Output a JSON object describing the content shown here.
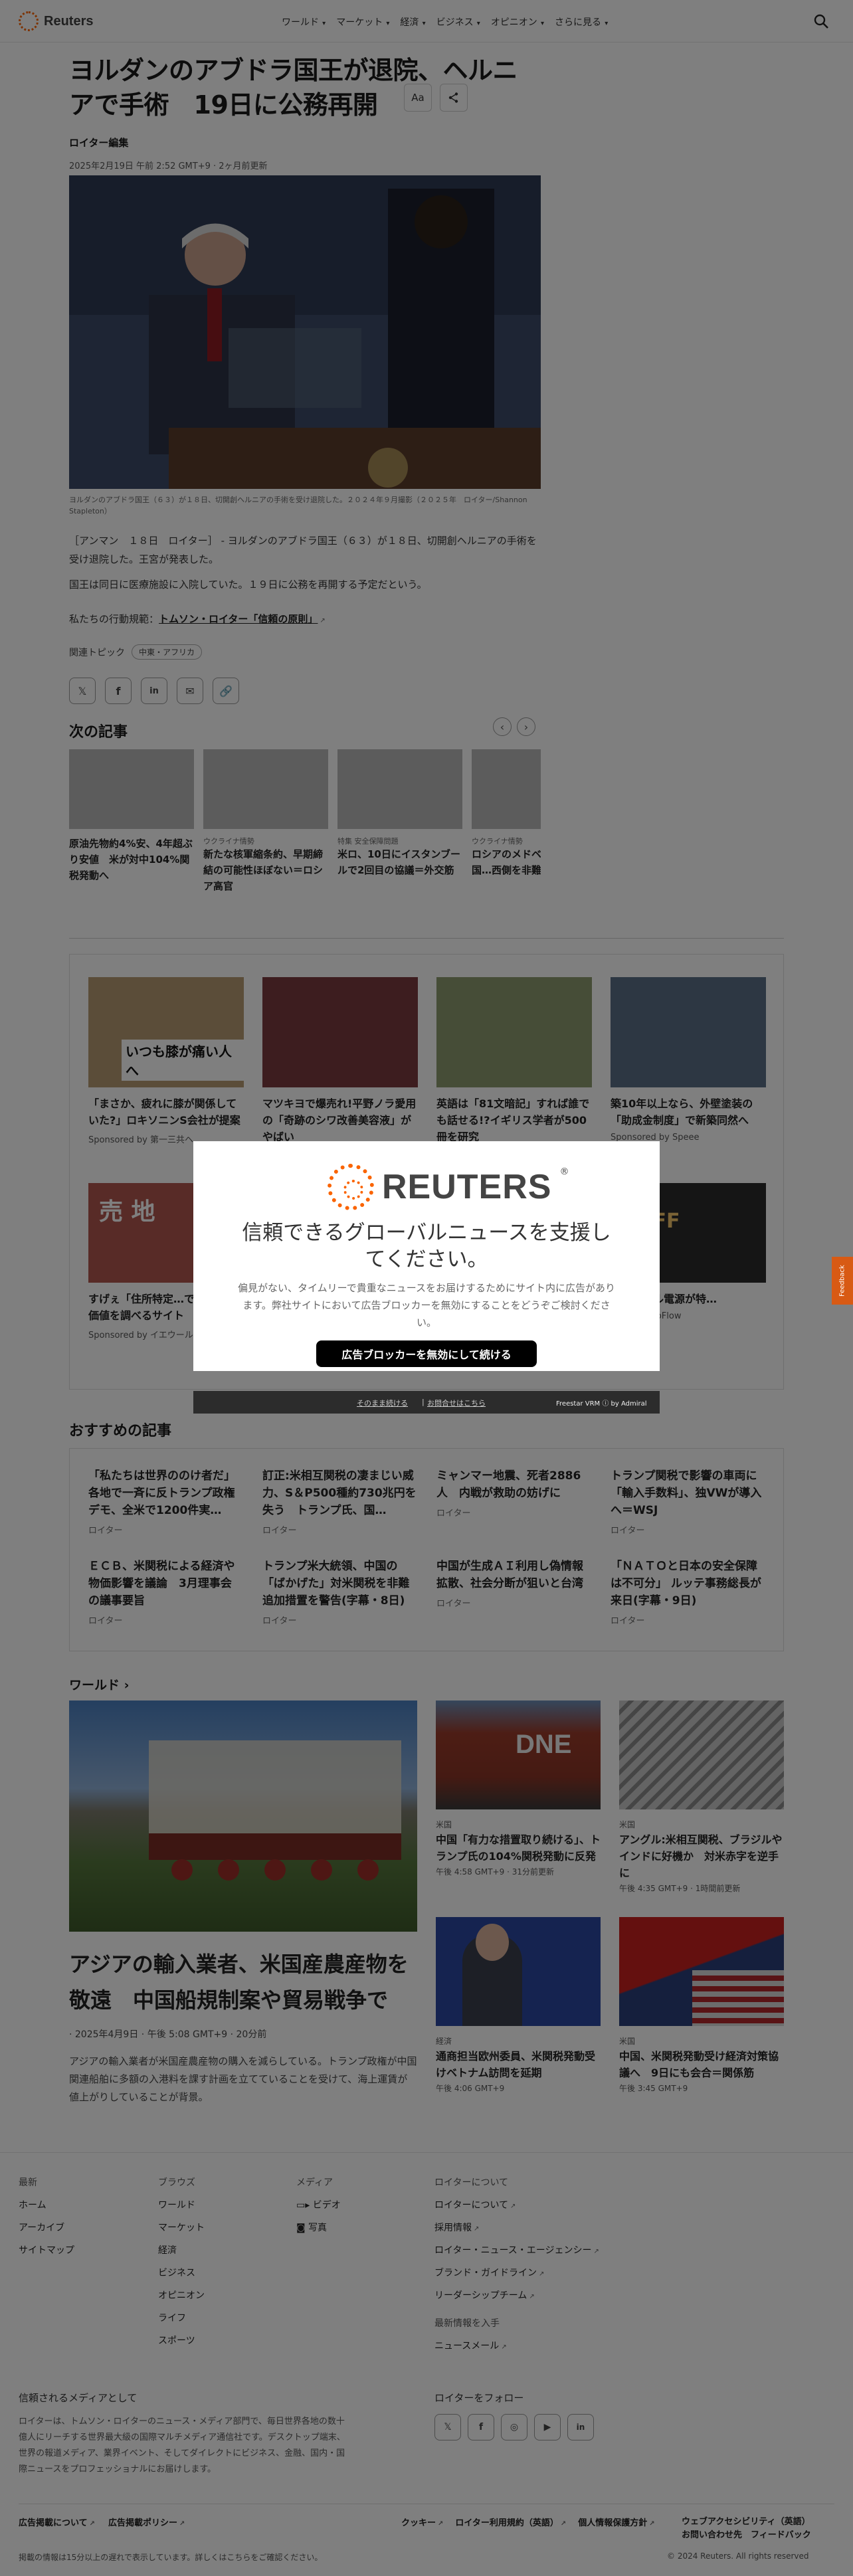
{
  "header": {
    "brand": "Reuters",
    "nav": [
      "ワールド",
      "マーケット",
      "経済",
      "ビジネス",
      "オピニオン",
      "さらに見る"
    ]
  },
  "article": {
    "headline": "ヨルダンのアブドラ国王が退院、ヘルニアで手術　19日に公務再開",
    "byline": "ロイター編集",
    "dateline": "2025年2月19日 午前 2:52 GMT+9 · 2ヶ月前更新",
    "font_button": "Aa",
    "caption": "ヨルダンのアブドラ国王（６３）が１８日、切開創ヘルニアの手術を受け退院した。２０２４年９月撮影（２０２５年　ロイター/Shannon Stapleton）",
    "para1": "［アンマン　１８日　ロイター］ - ヨルダンのアブドラ国王（６３）が１８日、切開創ヘルニアの手術を受け退院した。王宮が発表した。",
    "para2": "国王は同日に医療施設に入院していた。１９日に公務を再開する予定だという。",
    "standards_prefix": "私たちの行動規範：",
    "standards_link": "トムソン・ロイター「信頼の原則」",
    "topics_label": "関連トピック",
    "topic_tag": "中東・アフリカ"
  },
  "next": {
    "title": "次の記事",
    "items": [
      {
        "kicker": "",
        "title": "原油先物約4%安、4年超ぶり安値　米が対中104%関税発動へ"
      },
      {
        "kicker": "ウクライナ情勢",
        "title": "新たな核軍縮条約、早期締結の可能性ほぼない＝ロシア高官"
      },
      {
        "kicker": "特集 安全保障問題",
        "title": "米ロ、10日にイスタンブールで2回目の協議＝外交筋"
      },
      {
        "kicker": "ウクライナ情勢",
        "title": "ロシアのメドベ氏、核保有国…西側を非難"
      }
    ]
  },
  "sponsored": {
    "items": [
      {
        "title": "「まさか、疲れに膝が関係していた?」ロキソニンS会社が提案",
        "sponsor": "Sponsored by 第一三共ヘ…",
        "img_text": "いつも膝が痛い人へ"
      },
      {
        "title": "マツキヨで爆売れ!平野ノラ愛用の「奇跡のシワ改善美容液」がやばい",
        "sponsor": ""
      },
      {
        "title": "英語は「81文暗記」すれば誰でも話せる!?イギリス学者が500冊を研究",
        "sponsor": ""
      },
      {
        "title": "築10年以上なら、外壁塗装の「助成金制度」で新築同然へ",
        "sponsor": "Sponsored by Speee"
      },
      {
        "title": "すげぇ「住所特定…でOK」家の価値を調べるサイト",
        "sponsor": "Sponsored by イエウール",
        "img_text": "売 地"
      },
      {
        "title": "",
        "sponsor": ""
      },
      {
        "title": "",
        "sponsor": ""
      },
      {
        "title": "…ータブル電源が特…",
        "sponsor": "…ed by EcoFlow",
        "img_text": "%OFF"
      }
    ]
  },
  "recommended": {
    "title": "おすすめの記事",
    "items": [
      {
        "title": "「私たちは世界ののけ者だ」各地で一斉に反トランプ政権デモ、全米で1200件実…",
        "source": "ロイター"
      },
      {
        "title": "訂正:米相互関税の凄まじい威力、S＆P500種約730兆円を失う　トランプ氏、国…",
        "source": "ロイター"
      },
      {
        "title": "ミャンマー地震、死者2886人　内戦が救助の妨げに",
        "source": "ロイター"
      },
      {
        "title": "トランプ関税で影響の車両に「輸入手数料」、独VWが導入へ＝WSJ",
        "source": "ロイター"
      },
      {
        "title": "ＥＣＢ、米関税による経済や物価影響を議論　3月理事会の議事要旨",
        "source": "ロイター"
      },
      {
        "title": "トランプ米大統領、中国の「ばかげた」対米関税を非難　追加措置を警告(字幕・8日)",
        "source": "ロイター"
      },
      {
        "title": "中国が生成ＡＩ利用し偽情報拡散、社会分断が狙いと台湾",
        "source": "ロイター"
      },
      {
        "title": "「ＮＡＴＯと日本の安全保障は不可分」 ルッテ事務総長が来日(字幕・9日)",
        "source": "ロイター"
      }
    ]
  },
  "world": {
    "title": "ワールド",
    "main": {
      "title": "アジアの輸入業者、米国産農産物を敬遠　中国船規制案や貿易戦争で",
      "date": "· 2025年4月9日 · 午後 5:08 GMT+9 · 20分前",
      "summary": "アジアの輸入業者が米国産農産物の購入を減らしている。トランプ政権が中国関連船舶に多額の入港料を課す計画を立てていることを受けて、海上運賃が値上がりしていることが背景。"
    },
    "cards": [
      {
        "kicker": "米国",
        "title": "中国「有力な措置取り続ける」、トランプ氏の104%関税発動に反発",
        "date": "午後 4:58 GMT+9 · 31分前更新",
        "img_text": "DNE"
      },
      {
        "kicker": "米国",
        "title": "アングル:米相互関税、ブラジルやインドに好機か　対米赤字を逆手に",
        "date": "午後 4:35 GMT+9 · 1時間前更新"
      },
      {
        "kicker": "経済",
        "title": "通商担当欧州委員、米関税発動受けベトナム訪問を延期",
        "date": "午後 4:06 GMT+9"
      },
      {
        "kicker": "米国",
        "title": "中国、米関税発動受け経済対策協議へ　9日にも会合＝関係筋",
        "date": "午後 3:45 GMT+9"
      }
    ]
  },
  "footer": {
    "col1": {
      "head": "最新",
      "items": [
        "ホーム",
        "アーカイブ",
        "サイトマップ"
      ]
    },
    "col2": {
      "head": "ブラウズ",
      "items": [
        "ワールド",
        "マーケット",
        "経済",
        "ビジネス",
        "オピニオン",
        "ライフ",
        "スポーツ"
      ]
    },
    "col3": {
      "head": "メディア",
      "items": [
        "ビデオ",
        "写真"
      ]
    },
    "col4": {
      "head": "ロイターについて",
      "items": [
        "ロイターについて",
        "採用情報",
        "ロイター・ニュース・エージェンシー",
        "ブランド・ガイドライン",
        "リーダーシップチーム"
      ]
    },
    "col5": {
      "head": "最新情報を入手",
      "items": [
        "ニュースメール"
      ]
    },
    "trusted_title": "信頼されるメディアとして",
    "trusted_body": "ロイターは、トムソン・ロイターのニュース・メディア部門で、毎日世界各地の数十億人にリーチする世界最大級の国際マルチメディア通信社です。デスクトップ端末、世界の報道メディア、業界イベント、そしてダイレクトにビジネス、金融、国内・国際ニュースをプロフェッショナルにお届けします。",
    "follow_title": "ロイターをフォロー",
    "legal_left": [
      "広告掲載について",
      "広告掲載ポリシー"
    ],
    "legal_right": [
      "クッキー",
      "ロイター利用規約（英語）",
      "個人情報保護方針"
    ],
    "legal_stack": [
      "ウェブアクセシビリティ（英語）",
      "お問い合わせ先　フィードバック"
    ],
    "delay": "掲載の情報は15分以上の遅れで表示しています。詳しくはこちらをご確認ください。",
    "copyright": "© 2024 Reuters. All rights reserved"
  },
  "modal": {
    "brand": "REUTERS",
    "title": "信頼できるグローバルニュースを支援してください。",
    "body": "偏見がない、タイムリーで貴重なニュースをお届けするためにサイト内に広告があります。弊社サイトにおいて広告ブロッカーを無効にすることをどうぞご検討ください。",
    "button": "広告ブロッカーを無効にして続ける",
    "continue_link": "そのまま続ける",
    "sep": "|",
    "help_link": "お問合せはこちら",
    "powered": "Freestar VRM ⓘ by Admiral"
  },
  "feedback": "Feedback",
  "colors": {
    "accent": "#fa6400",
    "modal_button": "#000000",
    "feedback": "#d85a14"
  }
}
